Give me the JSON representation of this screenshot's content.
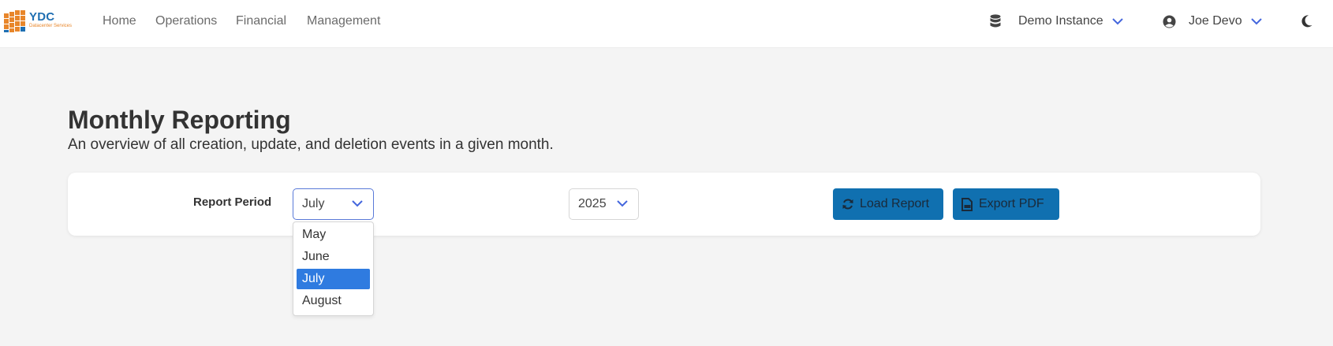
{
  "brand": {
    "name": "YDC",
    "tagline": "Datacenter Services",
    "colors": {
      "primary": "#1f6fb2",
      "accent": "#e8862a"
    }
  },
  "nav": {
    "links": [
      {
        "label": "Home"
      },
      {
        "label": "Operations"
      },
      {
        "label": "Financial"
      },
      {
        "label": "Management"
      }
    ],
    "instance": {
      "icon": "database-icon",
      "label": "Demo Instance"
    },
    "user": {
      "icon": "user-circle-icon",
      "label": "Joe Devo"
    },
    "theme_toggle": {
      "icon": "moon-icon"
    }
  },
  "page": {
    "title": "Monthly Reporting",
    "subtitle": "An overview of all creation, update, and deletion events in a given month."
  },
  "report": {
    "period_label": "Report Period",
    "month": {
      "value": "July",
      "options": [
        "May",
        "June",
        "July",
        "August"
      ],
      "selected_index": 2
    },
    "year": {
      "value": "2025"
    },
    "load_button": {
      "icon": "refresh-icon",
      "label": "Load Report"
    },
    "export_button": {
      "icon": "pdf-file-icon",
      "label": "Export PDF"
    }
  },
  "colors": {
    "button_bg": "#1070b0",
    "select_focus_border": "#5a7ad8",
    "option_highlight": "#2f7be0",
    "chevron": "#4466dd"
  }
}
